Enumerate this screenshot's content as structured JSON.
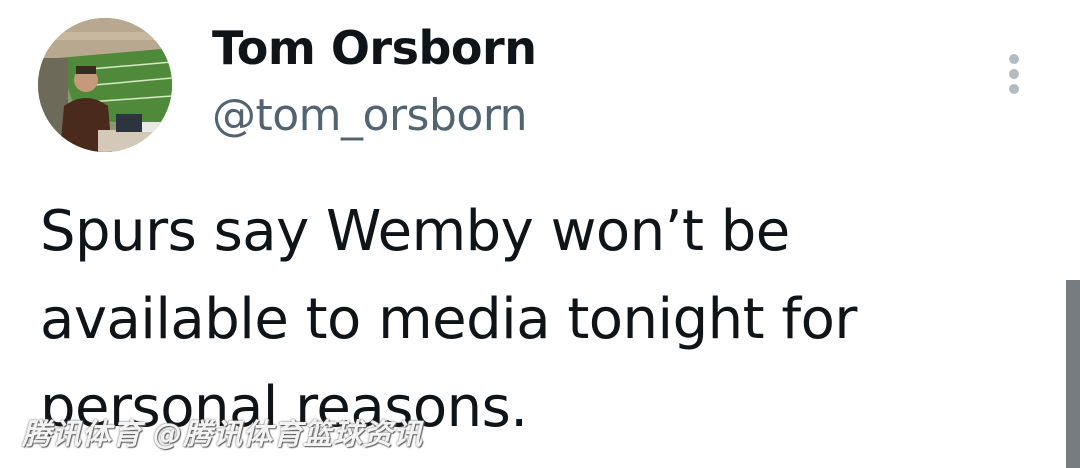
{
  "author": {
    "display_name": "Tom Orsborn",
    "handle": "@tom_orsborn",
    "avatar_icon": "profile-photo-stadium"
  },
  "tweet": {
    "text": "Spurs say Wemby won’t be\navailable to media tonight for\npersonal reasons."
  },
  "menu": {
    "icon": "more-vertical-icon"
  },
  "watermark": {
    "text": "腾讯体育 @腾讯体育篮球资讯"
  },
  "colors": {
    "text_primary": "#0f1419",
    "text_secondary": "#536471",
    "background": "#ffffff"
  }
}
